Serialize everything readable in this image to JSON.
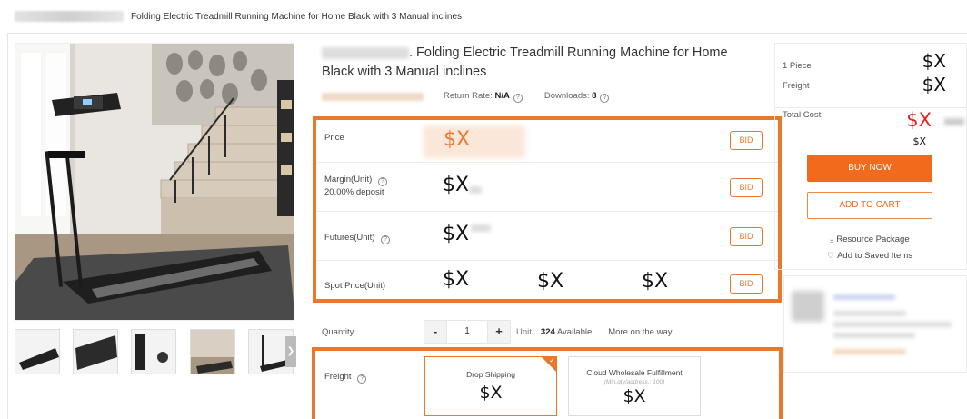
{
  "breadcrumb": {
    "current": "Folding Electric Treadmill Running Machine for Home Black with 3 Manual inclines"
  },
  "product": {
    "title": ". Folding Electric Treadmill Running Machine for Home Black with 3 Manual inclines",
    "return_rate_label": "Return Rate: ",
    "return_rate_value": "N/A",
    "downloads_label": "Downloads: ",
    "downloads_value": "8"
  },
  "pricing": {
    "price_label": "Price",
    "price_value": "$X",
    "margin_label": "Margin(Unit)",
    "margin_note": "20.00% deposit",
    "margin_value": "$X",
    "futures_label": "Futures(Unit)",
    "futures_value": "$X",
    "spot_label": "Spot Price(Unit)",
    "spot_values": [
      "$X",
      "$X",
      "$X"
    ],
    "bid_label": "BID"
  },
  "quantity": {
    "label": "Quantity",
    "minus": "-",
    "value": "1",
    "plus": "+",
    "unit": "Unit",
    "available_count": "324",
    "available_label": " Available",
    "more": "More on the way"
  },
  "freight": {
    "label": "Freight",
    "options": [
      {
        "title": "Drop Shipping",
        "subtitle": "",
        "value": "$X",
        "selected": true
      },
      {
        "title": "Cloud Wholesale Fulfillment",
        "subtitle": "(Min.qty/address.: 100)",
        "value": "$X",
        "selected": false
      }
    ]
  },
  "buybox": {
    "piece_label": "1 Piece",
    "piece_value": "$X",
    "freight_label": "Freight",
    "freight_value": "$X",
    "total_label": "Total Cost",
    "total_value": "$X",
    "total_sub": "$X",
    "buy_now": "BUY NOW",
    "add_to_cart": "ADD TO CART",
    "resource_package": "Resource Package",
    "add_saved": "Add to Saved Items"
  },
  "colors": {
    "accent": "#e8782c",
    "buy_now": "#f26b1c",
    "total_red": "#e52222"
  },
  "icons": [
    "question-icon",
    "download-icon",
    "heart-icon",
    "chevron-right-icon",
    "checkmark-icon"
  ]
}
